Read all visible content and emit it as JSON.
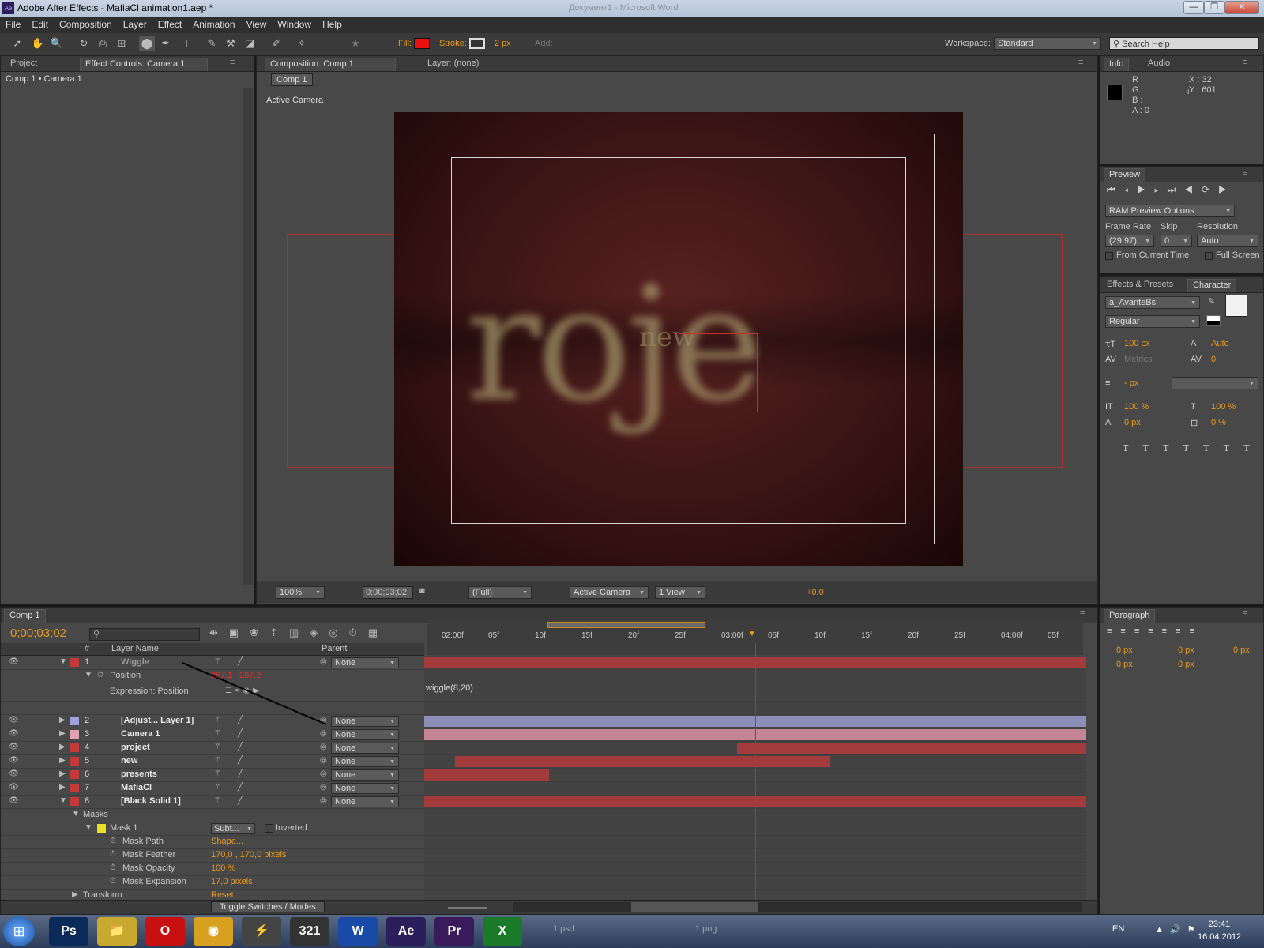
{
  "window": {
    "title": "Adobe After Effects - MafiaCl animation1.aep *",
    "bg_title": "Документ1 - Microsoft Word",
    "min": "—",
    "max": "❐",
    "close": "✕"
  },
  "menu": [
    "File",
    "Edit",
    "Composition",
    "Layer",
    "Effect",
    "Animation",
    "View",
    "Window",
    "Help"
  ],
  "toolbar": {
    "fill_label": "Fill:",
    "stroke_label": "Stroke:",
    "stroke_px": "2 px",
    "add_label": "Add:",
    "workspace_label": "Workspace:",
    "workspace": "Standard",
    "search_help": "Search Help",
    "fill_color": "#e81010"
  },
  "left_panel": {
    "tab_project": "Project",
    "tab_effect": "Effect Controls: Camera 1",
    "breadcrumb": "Comp 1 • Camera 1"
  },
  "comp_panel": {
    "tab": "Composition: Comp 1",
    "layer_tab": "Layer: (none)",
    "comp_button": "Comp 1",
    "active_camera": "Active Camera",
    "zoom": "100%",
    "timecode": "0;00;03;02",
    "resolution": "(Full)",
    "view": "Active Camera",
    "views": "1 View",
    "exposure": "+0,0",
    "canvas_text": "roje",
    "canvas_small": "new"
  },
  "info_panel": {
    "tab_info": "Info",
    "tab_audio": "Audio",
    "r": "R :",
    "g": "G :",
    "b": "B :",
    "a": "A : 0",
    "x": "X : 32",
    "y": "Y : 601"
  },
  "preview_panel": {
    "tab": "Preview",
    "ram": "RAM Preview Options",
    "frame_rate_label": "Frame Rate",
    "skip_label": "Skip",
    "resolution_label": "Resolution",
    "frame_rate": "(29,97)",
    "skip": "0",
    "resolution": "Auto",
    "from_current": "From Current Time",
    "full_screen": "Full Screen"
  },
  "character_panel": {
    "tab_effects": "Effects & Presets",
    "tab_char": "Character",
    "font": "a_AvanteBs",
    "style": "Regular",
    "size": "100 px",
    "leading": "Auto",
    "kerning": "Metrics",
    "tracking": "0",
    "stroke": "- px",
    "vscale": "100 %",
    "hscale": "100 %",
    "baseline": "0 px",
    "tsume": "0 %"
  },
  "paragraph_panel": {
    "tab": "Paragraph",
    "v1": "0 px",
    "v2": "0 px",
    "v3": "0 px",
    "v4": "0 px",
    "v5": "0 px"
  },
  "timeline": {
    "tab": "Comp 1",
    "timecode": "0;00;03;02",
    "col_num": "#",
    "col_layer": "Layer Name",
    "col_parent": "Parent",
    "ruler": [
      "02:00f",
      "05f",
      "10f",
      "15f",
      "20f",
      "25f",
      "03:00f",
      "05f",
      "10f",
      "15f",
      "20f",
      "25f",
      "04:00f",
      "05f"
    ],
    "toggle": "Toggle Switches / Modes",
    "expression": "wiggle(8,20)"
  },
  "layers": [
    {
      "num": "1",
      "name": "Wiggle",
      "color": "#c43a3a",
      "parent": "None",
      "bar": "#a23c3c",
      "start": 0,
      "end": 1
    },
    {
      "num": "2",
      "name": "[Adjust... Layer 1]",
      "color": "#9ea0d8",
      "parent": "None",
      "bar": "#8e8fb9",
      "start": 0,
      "end": 1
    },
    {
      "num": "3",
      "name": "Camera 1",
      "color": "#e0a0b4",
      "parent": "None",
      "bar": "#c48597",
      "start": 0,
      "end": 1
    },
    {
      "num": "4",
      "name": "project",
      "color": "#c43a3a",
      "parent": "None",
      "bar": "#a23c3c",
      "start": 0.472,
      "end": 1
    },
    {
      "num": "5",
      "name": "new",
      "color": "#c43a3a",
      "parent": "None",
      "bar": "#a23c3c",
      "start": 0.046,
      "end": 0.613
    },
    {
      "num": "6",
      "name": "presents",
      "color": "#c43a3a",
      "parent": "None",
      "bar": "#a23c3c",
      "start": 0,
      "end": 0.188
    },
    {
      "num": "7",
      "name": "MafiaCl",
      "color": "#c43a3a",
      "parent": "None",
      "bar": "#a23c3c",
      "start": 0,
      "end": 0
    },
    {
      "num": "8",
      "name": "[Black Solid 1]",
      "color": "#c43a3a",
      "parent": "None",
      "bar": "#a23c3c",
      "start": 0,
      "end": 1
    }
  ],
  "props": {
    "position_label": "Position",
    "position_x": "267,1",
    "position_y": "287,2",
    "expr_label": "Expression: Position",
    "masks": "Masks",
    "mask1": "Mask 1",
    "mask_mode": "Subt...",
    "inverted": "Inverted",
    "mask_path": "Mask Path",
    "mask_path_val": "Shape...",
    "mask_feather": "Mask Feather",
    "mask_feather_val": "170,0 , 170,0 pixels",
    "mask_opacity": "Mask Opacity",
    "mask_opacity_val": "100 %",
    "mask_expansion": "Mask Expansion",
    "mask_expansion_val": "17,0 pixels",
    "transform": "Transform",
    "transform_val": "Reset"
  },
  "taskbar": {
    "lang": "EN",
    "time": "23:41",
    "date": "16.04.2012",
    "apps": [
      "Ps",
      "📁",
      "O",
      "◉",
      "⚡",
      "321",
      "W",
      "Ae",
      "Pr",
      "X"
    ],
    "ghosts": [
      "1.psd",
      "1.png"
    ]
  }
}
